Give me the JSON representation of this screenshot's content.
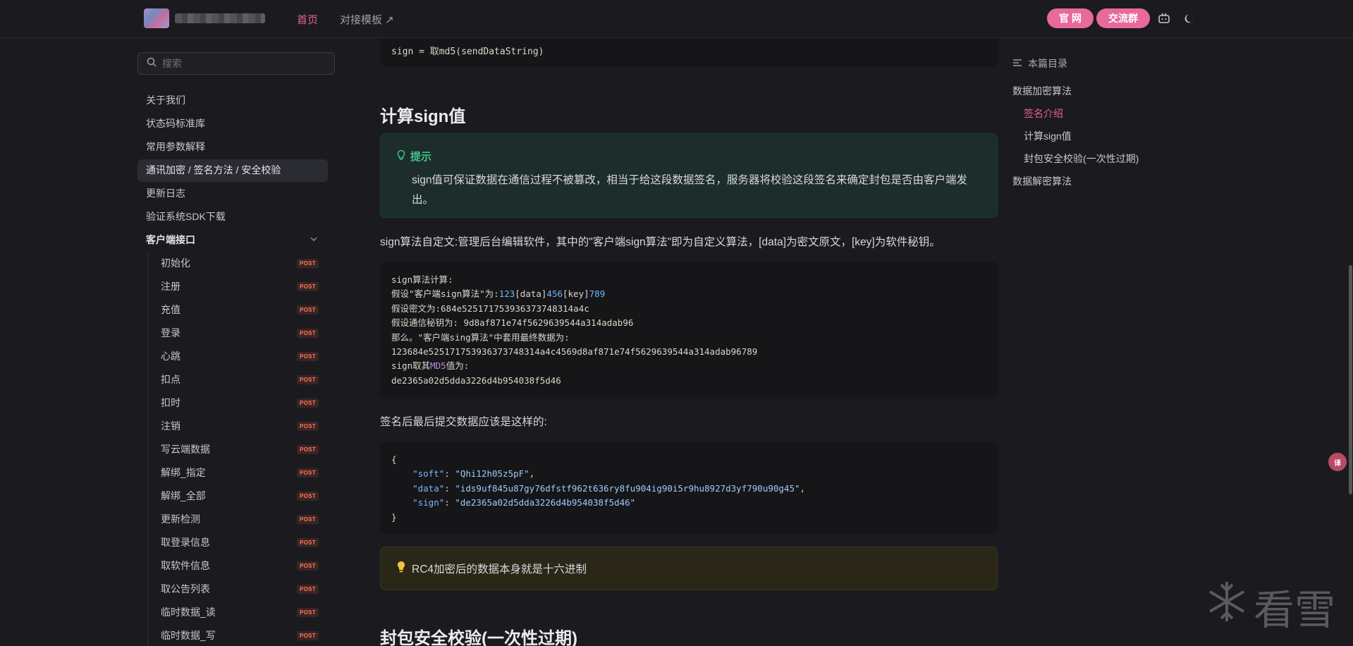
{
  "nav": {
    "home": "首页",
    "template": "对接模板 ↗",
    "official_btn": "官 网",
    "group_btn": "交流群"
  },
  "sidebar": {
    "search_placeholder": "搜索",
    "items": [
      {
        "label": "关于我们"
      },
      {
        "label": "状态码标准库"
      },
      {
        "label": "常用参数解释"
      },
      {
        "label": "通讯加密 / 签名方法 / 安全校验"
      },
      {
        "label": "更新日志"
      },
      {
        "label": "验证系统SDK下载"
      }
    ],
    "group_label": "客户端接口",
    "api_items": [
      {
        "label": "初始化",
        "method": "POST"
      },
      {
        "label": "注册",
        "method": "POST"
      },
      {
        "label": "充值",
        "method": "POST"
      },
      {
        "label": "登录",
        "method": "POST"
      },
      {
        "label": "心跳",
        "method": "POST"
      },
      {
        "label": "扣点",
        "method": "POST"
      },
      {
        "label": "扣时",
        "method": "POST"
      },
      {
        "label": "注销",
        "method": "POST"
      },
      {
        "label": "写云端数据",
        "method": "POST"
      },
      {
        "label": "解绑_指定",
        "method": "POST"
      },
      {
        "label": "解绑_全部",
        "method": "POST"
      },
      {
        "label": "更新检测",
        "method": "POST"
      },
      {
        "label": "取登录信息",
        "method": "POST"
      },
      {
        "label": "取软件信息",
        "method": "POST"
      },
      {
        "label": "取公告列表",
        "method": "POST"
      },
      {
        "label": "临时数据_读",
        "method": "POST"
      },
      {
        "label": "临时数据_写",
        "method": "POST"
      }
    ]
  },
  "content": {
    "top_code_line": "sign = 取md5(sendDataString)",
    "heading_sign": "计算sign值",
    "tip_title": "提示",
    "tip_body": "sign值可保证数据在通信过程不被篡改，相当于给这段数据签名，服务器将校验这段签名来确定封包是否由客户端发出。",
    "custom_sign_para": "sign算法自定文:管理后台编辑软件，其中的\"客户端sign算法\"即为自定义算法，[data]为密文原文，[key]为软件秘钥。",
    "code1": {
      "l1": "sign算法计算:",
      "l2_a": "假设\"客户端sign算法\"为:",
      "l2_n1": "123",
      "l2_b": "[data]",
      "l2_n2": "456",
      "l2_c": "[key]",
      "l2_n3": "789",
      "l3": "假设密文为:684e525171753936373748314a4c",
      "l4": "假设通信秘钥为: 9d8af871e74f5629639544a314adab96",
      "l5": "那么。\"客户端sing算法\"中套用最终数据为:",
      "l6": "123684e525171753936373748314a4c4569d8af871e74f5629639544a314adab96789",
      "l7_a": "sign取其",
      "l7_kw": "MD5",
      "l7_b": "值为:",
      "l8": "de2365a02d5dda3226d4b954038f5d46"
    },
    "submit_para": "签名后最后提交数据应该是这样的:",
    "code2": {
      "open": "{",
      "soft_key": "\"soft\"",
      "soft_val": "\"Qhi12h05z5pF\"",
      "data_key": "\"data\"",
      "data_val": "\"ids9uf845u87gy76dfstf962t636ry8fu904ig90i5r9hu8927d3yf790u90g45\"",
      "sign_key": "\"sign\"",
      "sign_val": "\"de2365a02d5dda3226d4b954038f5d46\"",
      "close": "}"
    },
    "warn_text": "RC4加密后的数据本身就是十六进制",
    "heading_packet": "封包安全校验(一次性过期)"
  },
  "outline": {
    "title": "本篇目录",
    "items": [
      {
        "label": "数据加密算法"
      },
      {
        "label": "签名介绍"
      },
      {
        "label": "计算sign值"
      },
      {
        "label": "封包安全校验(一次性过期)"
      },
      {
        "label": "数据解密算法"
      }
    ]
  },
  "float_button": "译",
  "watermark": "看雪",
  "colors": {
    "accent": "#e65f95",
    "tip_green": "#3fc28d",
    "post_badge": "#ff7759"
  }
}
